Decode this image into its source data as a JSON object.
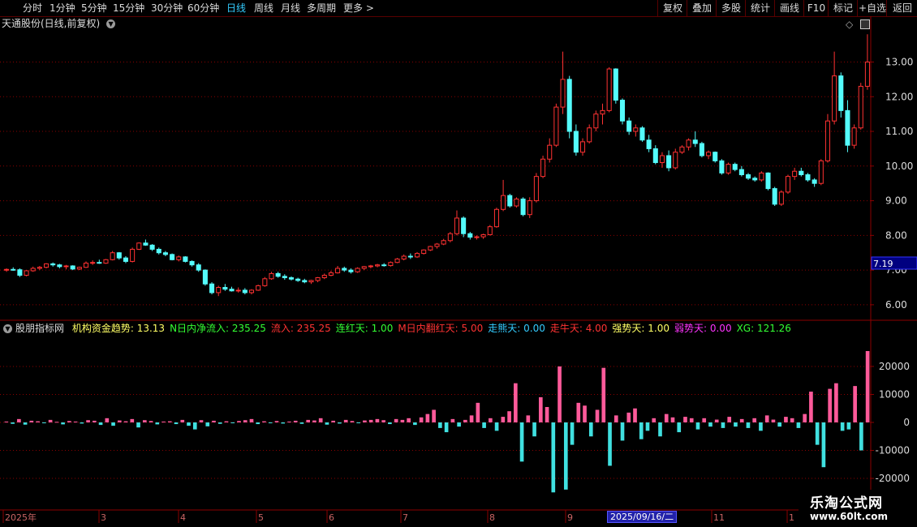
{
  "toolbar": {
    "periods": [
      "分时",
      "1分钟",
      "5分钟",
      "15分钟",
      "30分钟",
      "60分钟",
      "日线",
      "周线",
      "月线",
      "多周期",
      "更多 >"
    ],
    "active_period": "日线",
    "buttons": [
      "复权",
      "叠加",
      "多股",
      "统计",
      "画线",
      "F10",
      "标记",
      "+自选",
      "返回"
    ]
  },
  "chart_title": "天通股份(日线,前复权)",
  "indicator": {
    "name": "股朋指标网",
    "items": [
      {
        "label": "机构资金趋势: 13.13",
        "color": "#ffff66"
      },
      {
        "label": "N日内净流入: 235.25",
        "color": "#33ff33"
      },
      {
        "label": "流入: 235.25",
        "color": "#ff3333"
      },
      {
        "label": "连红天: 1.00",
        "color": "#33ff33"
      },
      {
        "label": "M日内翻红天: 5.00",
        "color": "#ff3333"
      },
      {
        "label": "走熊天: 0.00",
        "color": "#33ccff"
      },
      {
        "label": "走牛天: 4.00",
        "color": "#ff3333"
      },
      {
        "label": "强势天: 1.00",
        "color": "#ffff66"
      },
      {
        "label": "弱势天: 0.00",
        "color": "#ff33ff"
      },
      {
        "label": "XG: 121.26",
        "color": "#33ff33"
      }
    ]
  },
  "price_axis": [
    "13.00",
    "12.00",
    "11.00",
    "10.00",
    "9.00",
    "8.00",
    "7.00",
    "6.00"
  ],
  "current_price_label": "7.19",
  "volume_axis": [
    "20000",
    "10000",
    "0",
    "-10000",
    "-20000"
  ],
  "date_axis": [
    "2025年",
    "3",
    "4",
    "5",
    "6",
    "7",
    "8",
    "9",
    "11",
    "1"
  ],
  "hover_date": "2025/09/16/二",
  "watermark": {
    "line1": "乐淘公式网",
    "line2": "www.60lt.com"
  },
  "colors": {
    "up": "#ff3232",
    "down": "#54fcfc",
    "pos_bar": "#ff5a9a",
    "neg_bar": "#40e0e0",
    "grid": "#8b0000"
  },
  "chart_data": {
    "type": "candlestick",
    "title": "天通股份(日线,前复权)",
    "y_range": [
      5.6,
      13.9
    ],
    "price_ticks": [
      6,
      7,
      8,
      9,
      10,
      11,
      12,
      13
    ],
    "ohlc": [
      [
        7.0,
        7.05,
        6.95,
        7.02
      ],
      [
        7.02,
        7.08,
        6.98,
        7.01
      ],
      [
        7.01,
        7.05,
        6.8,
        6.85
      ],
      [
        6.85,
        7.0,
        6.82,
        6.98
      ],
      [
        6.98,
        7.1,
        6.95,
        7.05
      ],
      [
        7.05,
        7.12,
        7.0,
        7.08
      ],
      [
        7.08,
        7.2,
        7.05,
        7.18
      ],
      [
        7.18,
        7.22,
        7.1,
        7.15
      ],
      [
        7.15,
        7.18,
        7.05,
        7.1
      ],
      [
        7.1,
        7.15,
        7.02,
        7.12
      ],
      [
        7.12,
        7.14,
        7.0,
        7.03
      ],
      [
        7.03,
        7.1,
        7.0,
        7.08
      ],
      [
        7.08,
        7.25,
        7.06,
        7.2
      ],
      [
        7.2,
        7.28,
        7.15,
        7.22
      ],
      [
        7.22,
        7.3,
        7.18,
        7.2
      ],
      [
        7.2,
        7.32,
        7.18,
        7.3
      ],
      [
        7.3,
        7.55,
        7.28,
        7.5
      ],
      [
        7.5,
        7.52,
        7.3,
        7.35
      ],
      [
        7.35,
        7.4,
        7.2,
        7.25
      ],
      [
        7.25,
        7.65,
        7.22,
        7.6
      ],
      [
        7.6,
        7.8,
        7.58,
        7.78
      ],
      [
        7.78,
        7.88,
        7.7,
        7.72
      ],
      [
        7.72,
        7.75,
        7.55,
        7.6
      ],
      [
        7.6,
        7.65,
        7.45,
        7.5
      ],
      [
        7.5,
        7.55,
        7.4,
        7.45
      ],
      [
        7.45,
        7.48,
        7.28,
        7.3
      ],
      [
        7.3,
        7.42,
        7.25,
        7.38
      ],
      [
        7.38,
        7.4,
        7.22,
        7.25
      ],
      [
        7.25,
        7.28,
        7.1,
        7.15
      ],
      [
        7.15,
        7.2,
        6.95,
        7.0
      ],
      [
        7.0,
        7.02,
        6.55,
        6.6
      ],
      [
        6.6,
        6.65,
        6.3,
        6.35
      ],
      [
        6.35,
        6.55,
        6.25,
        6.5
      ],
      [
        6.5,
        6.6,
        6.4,
        6.45
      ],
      [
        6.45,
        6.52,
        6.38,
        6.4
      ],
      [
        6.4,
        6.5,
        6.35,
        6.42
      ],
      [
        6.42,
        6.48,
        6.3,
        6.35
      ],
      [
        6.35,
        6.45,
        6.3,
        6.42
      ],
      [
        6.42,
        6.58,
        6.4,
        6.55
      ],
      [
        6.55,
        6.8,
        6.52,
        6.75
      ],
      [
        6.75,
        6.95,
        6.72,
        6.9
      ],
      [
        6.9,
        6.95,
        6.78,
        6.82
      ],
      [
        6.82,
        6.88,
        6.72,
        6.78
      ],
      [
        6.78,
        6.82,
        6.7,
        6.74
      ],
      [
        6.74,
        6.78,
        6.66,
        6.7
      ],
      [
        6.7,
        6.75,
        6.62,
        6.66
      ],
      [
        6.66,
        6.72,
        6.6,
        6.7
      ],
      [
        6.7,
        6.8,
        6.65,
        6.78
      ],
      [
        6.78,
        6.9,
        6.74,
        6.85
      ],
      [
        6.85,
        6.98,
        6.82,
        6.92
      ],
      [
        6.92,
        7.12,
        6.9,
        7.05
      ],
      [
        7.05,
        7.1,
        6.95,
        7.0
      ],
      [
        7.0,
        7.05,
        6.9,
        6.95
      ],
      [
        6.95,
        7.08,
        6.92,
        7.05
      ],
      [
        7.05,
        7.12,
        7.0,
        7.1
      ],
      [
        7.1,
        7.15,
        7.05,
        7.12
      ],
      [
        7.12,
        7.18,
        7.08,
        7.15
      ],
      [
        7.15,
        7.2,
        7.1,
        7.13
      ],
      [
        7.13,
        7.25,
        7.1,
        7.22
      ],
      [
        7.22,
        7.35,
        7.2,
        7.32
      ],
      [
        7.32,
        7.45,
        7.28,
        7.4
      ],
      [
        7.4,
        7.48,
        7.32,
        7.38
      ],
      [
        7.38,
        7.52,
        7.35,
        7.48
      ],
      [
        7.48,
        7.6,
        7.45,
        7.58
      ],
      [
        7.58,
        7.7,
        7.55,
        7.68
      ],
      [
        7.68,
        7.78,
        7.62,
        7.75
      ],
      [
        7.75,
        7.9,
        7.72,
        7.85
      ],
      [
        7.85,
        8.1,
        7.8,
        8.05
      ],
      [
        8.05,
        8.72,
        8.0,
        8.5
      ],
      [
        8.5,
        8.55,
        7.95,
        8.05
      ],
      [
        8.05,
        8.1,
        7.88,
        7.95
      ],
      [
        7.95,
        8.0,
        7.88,
        7.96
      ],
      [
        7.96,
        8.05,
        7.9,
        8.02
      ],
      [
        8.02,
        8.3,
        8.0,
        8.25
      ],
      [
        8.25,
        8.8,
        8.22,
        8.75
      ],
      [
        8.75,
        9.6,
        8.7,
        9.15
      ],
      [
        9.15,
        9.2,
        8.8,
        8.85
      ],
      [
        8.85,
        9.1,
        8.8,
        9.05
      ],
      [
        9.05,
        9.1,
        8.55,
        8.6
      ],
      [
        8.6,
        9.1,
        8.5,
        9.0
      ],
      [
        9.0,
        9.8,
        8.95,
        9.7
      ],
      [
        9.7,
        10.3,
        9.65,
        10.2
      ],
      [
        10.2,
        10.8,
        10.1,
        10.6
      ],
      [
        10.6,
        11.8,
        10.55,
        11.7
      ],
      [
        11.7,
        13.3,
        11.5,
        12.5
      ],
      [
        12.5,
        12.6,
        10.8,
        11.0
      ],
      [
        11.0,
        11.2,
        10.3,
        10.4
      ],
      [
        10.4,
        10.8,
        10.3,
        10.7
      ],
      [
        10.7,
        11.2,
        10.65,
        11.1
      ],
      [
        11.1,
        11.6,
        11.0,
        11.5
      ],
      [
        11.5,
        11.8,
        11.2,
        11.6
      ],
      [
        11.6,
        12.85,
        11.55,
        12.8
      ],
      [
        12.8,
        12.82,
        11.8,
        11.9
      ],
      [
        11.9,
        11.95,
        11.2,
        11.3
      ],
      [
        11.3,
        11.4,
        10.9,
        11.0
      ],
      [
        11.0,
        11.2,
        10.85,
        11.1
      ],
      [
        11.1,
        11.15,
        10.7,
        10.75
      ],
      [
        10.75,
        10.9,
        10.4,
        10.5
      ],
      [
        10.5,
        10.6,
        10.05,
        10.1
      ],
      [
        10.1,
        10.4,
        9.95,
        10.3
      ],
      [
        10.3,
        10.45,
        9.85,
        9.95
      ],
      [
        9.95,
        10.5,
        9.9,
        10.4
      ],
      [
        10.4,
        10.6,
        10.35,
        10.55
      ],
      [
        10.55,
        10.8,
        10.45,
        10.75
      ],
      [
        10.75,
        11.0,
        10.55,
        10.65
      ],
      [
        10.65,
        10.7,
        10.25,
        10.3
      ],
      [
        10.3,
        10.45,
        10.2,
        10.4
      ],
      [
        10.4,
        10.42,
        10.1,
        10.15
      ],
      [
        10.15,
        10.2,
        9.75,
        9.8
      ],
      [
        9.8,
        10.1,
        9.75,
        10.05
      ],
      [
        10.05,
        10.1,
        9.85,
        9.9
      ],
      [
        9.9,
        10.0,
        9.7,
        9.75
      ],
      [
        9.75,
        9.8,
        9.6,
        9.65
      ],
      [
        9.65,
        9.7,
        9.55,
        9.6
      ],
      [
        9.6,
        9.85,
        9.55,
        9.8
      ],
      [
        9.8,
        9.82,
        9.3,
        9.35
      ],
      [
        9.35,
        9.4,
        8.85,
        8.9
      ],
      [
        8.9,
        9.3,
        8.85,
        9.25
      ],
      [
        9.25,
        9.75,
        9.2,
        9.7
      ],
      [
        9.7,
        9.95,
        9.6,
        9.85
      ],
      [
        9.85,
        9.95,
        9.7,
        9.75
      ],
      [
        9.75,
        9.8,
        9.55,
        9.6
      ],
      [
        9.6,
        9.65,
        9.4,
        9.5
      ],
      [
        9.5,
        10.2,
        9.45,
        10.15
      ],
      [
        10.15,
        11.5,
        10.1,
        11.3
      ],
      [
        11.3,
        13.3,
        11.2,
        12.6
      ],
      [
        12.6,
        12.7,
        11.4,
        11.6
      ],
      [
        11.6,
        11.9,
        10.4,
        10.6
      ],
      [
        10.6,
        11.2,
        10.5,
        11.1
      ],
      [
        11.1,
        12.4,
        11.05,
        12.3
      ],
      [
        12.3,
        13.8,
        12.2,
        13.0
      ]
    ],
    "volume_ylim": [
      -31000,
      31000
    ],
    "volume_ticks": [
      20000,
      10000,
      0,
      -10000,
      -20000
    ],
    "volume": [
      300,
      -500,
      1200,
      -800,
      600,
      400,
      -300,
      900,
      200,
      -700,
      500,
      300,
      -400,
      800,
      600,
      -900,
      1500,
      -1200,
      700,
      400,
      1200,
      -1800,
      800,
      500,
      -700,
      300,
      400,
      -600,
      900,
      -1200,
      -2500,
      800,
      -1400,
      600,
      -500,
      400,
      -300,
      500,
      800,
      1200,
      -600,
      400,
      -300,
      500,
      -400,
      300,
      600,
      -500,
      900,
      700,
      1500,
      -800,
      600,
      -400,
      900,
      500,
      -300,
      700,
      900,
      1200,
      800,
      -600,
      1200,
      900,
      1500,
      -900,
      1800,
      3000,
      4500,
      -2000,
      -3500,
      1200,
      -1500,
      900,
      2500,
      7000,
      -2000,
      1500,
      -3000,
      2000,
      4000,
      14000,
      -14000,
      2500,
      -5000,
      9000,
      5500,
      -25000,
      20000,
      -24000,
      -8000,
      7000,
      6000,
      -5000,
      4500,
      19500,
      -15500,
      2500,
      -6500,
      3500,
      5000,
      -6000,
      -3000,
      1500,
      -5000,
      3000,
      1800,
      -3500,
      2000,
      1500,
      -2500,
      1500,
      -1500,
      1000,
      -2000,
      2000,
      -1500,
      1200,
      -2000,
      1500,
      -3000,
      2500,
      1000,
      -1500,
      2000,
      1500,
      -2000,
      3000,
      11000,
      -8000,
      -16000,
      12000,
      14000,
      -3000,
      -2500,
      13000,
      -10000,
      25500
    ],
    "x_ticks": [
      "2025年",
      "3",
      "4",
      "5",
      "6",
      "7",
      "8",
      "9",
      "11",
      "1"
    ]
  }
}
